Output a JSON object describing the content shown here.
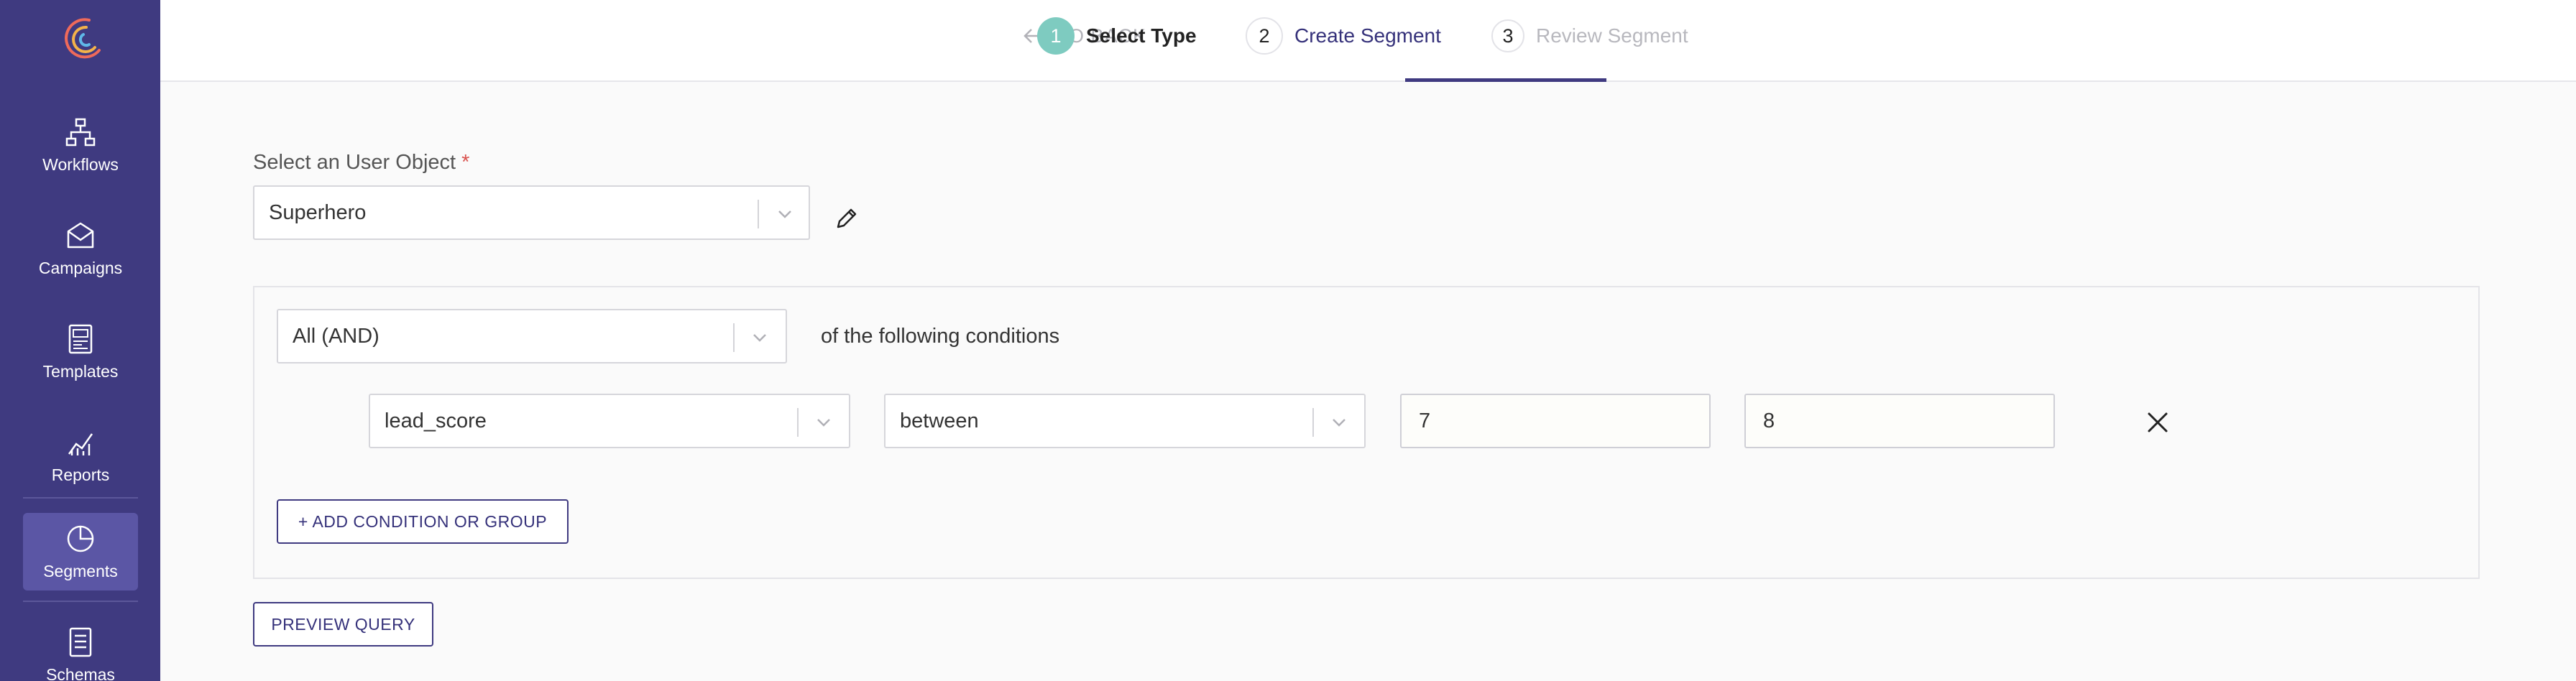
{
  "sidebar": {
    "items": [
      {
        "label": "Workflows",
        "icon": "workflow-icon"
      },
      {
        "label": "Campaigns",
        "icon": "envelope-icon"
      },
      {
        "label": "Templates",
        "icon": "template-icon"
      },
      {
        "label": "Reports",
        "icon": "chart-icon"
      },
      {
        "label": "Segments",
        "icon": "pie-icon",
        "active": true
      },
      {
        "label": "Schemas",
        "icon": "document-icon"
      }
    ]
  },
  "header": {
    "go_back": "GO BACK",
    "steps": [
      {
        "number": "1",
        "label": "Select Type",
        "state": "completed"
      },
      {
        "number": "2",
        "label": "Create Segment",
        "state": "active"
      },
      {
        "number": "3",
        "label": "Review Segment",
        "state": "upcoming"
      }
    ]
  },
  "form": {
    "user_object_label": "Select an User Object",
    "required_mark": "*",
    "user_object_value": "Superhero",
    "match_value": "All (AND)",
    "match_suffix": "of the following conditions",
    "condition": {
      "field": "lead_score",
      "operator": "between",
      "value_from": "7",
      "value_to": "8"
    },
    "add_condition_label": "+ ADD CONDITION OR GROUP",
    "preview_label": "PREVIEW QUERY"
  },
  "colors": {
    "sidebar_bg": "#3f3a80",
    "sidebar_active": "#5b56a5",
    "step_complete": "#7ecbc0",
    "accent": "#3f3a80"
  }
}
